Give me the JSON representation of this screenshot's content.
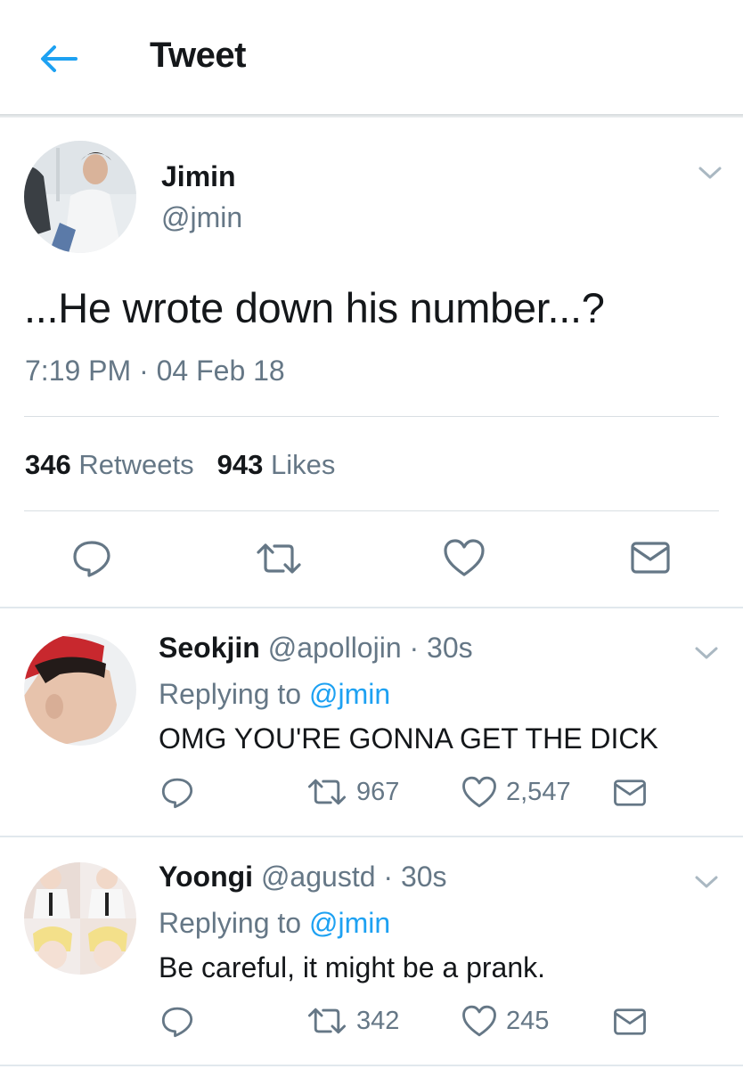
{
  "header": {
    "title": "Tweet",
    "back_icon": "arrow-left-icon",
    "accent": "#1da1f2"
  },
  "main_tweet": {
    "name": "Jimin",
    "handle": "@jmin",
    "text": "...He wrote down his number...?",
    "timestamp": "7:19 PM · 04 Feb 18",
    "retweets_count": "346",
    "retweets_label": "Retweets",
    "likes_count": "943",
    "likes_label": "Likes"
  },
  "replies": [
    {
      "name": "Seokjin",
      "handle": "@apollojin",
      "time": "· 30s",
      "replying_prefix": "Replying to",
      "replying_to": "@jmin",
      "text": "OMG YOU'RE GONNA GET THE DICK",
      "retweets": "967",
      "likes": "2,547"
    },
    {
      "name": "Yoongi",
      "handle": "@agustd",
      "time": "· 30s",
      "replying_prefix": "Replying to",
      "replying_to": "@jmin",
      "text": "Be careful, it might be a prank.",
      "retweets": "342",
      "likes": "245"
    }
  ],
  "colors": {
    "text": "#14171a",
    "secondary": "#657786",
    "link": "#1da1f2",
    "icon": "#657786"
  }
}
